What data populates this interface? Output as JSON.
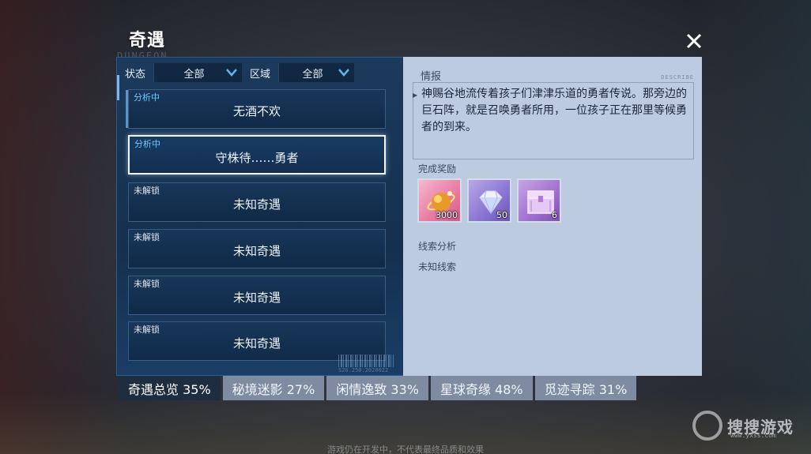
{
  "header": {
    "title": "奇遇",
    "close_icon": "close-icon"
  },
  "deco": {
    "dungeon": "DUNGEON",
    "describe": "DESCRIBE",
    "serial": "S20.250.2020022"
  },
  "filters": [
    {
      "label": "状态",
      "value": "全部"
    },
    {
      "label": "区域",
      "value": "全部"
    }
  ],
  "encounters": [
    {
      "status": "分析中",
      "name": "无酒不欢",
      "state": "active",
      "selected": false
    },
    {
      "status": "分析中",
      "name": "守株待……勇者",
      "state": "active",
      "selected": true
    },
    {
      "status": "未解锁",
      "name": "未知奇遇",
      "state": "locked",
      "selected": false
    },
    {
      "status": "未解锁",
      "name": "未知奇遇",
      "state": "locked",
      "selected": false
    },
    {
      "status": "未解锁",
      "name": "未知奇遇",
      "state": "locked",
      "selected": false
    },
    {
      "status": "未解锁",
      "name": "未知奇遇",
      "state": "locked",
      "selected": false
    }
  ],
  "detail": {
    "info_title": "情报",
    "info_text": "神赐谷地流传着孩子们津津乐道的勇者传说。那旁边的巨石阵，就是召唤勇者所用，一位孩子正在那里等候勇者的到来。",
    "reward_title": "完成奖励",
    "rewards": [
      {
        "icon": "gold-orb-icon",
        "qty": "3000"
      },
      {
        "icon": "diamond-icon",
        "qty": "50"
      },
      {
        "icon": "treasure-chest-icon",
        "qty": "6"
      }
    ],
    "clue_title": "线索分析",
    "clue_value": "未知线索"
  },
  "tabs": [
    {
      "label": "奇遇总览 35%",
      "active": true
    },
    {
      "label": "秘境迷影 27%",
      "active": false
    },
    {
      "label": "闲情逸致 33%",
      "active": false
    },
    {
      "label": "星球奇缘 48%",
      "active": false
    },
    {
      "label": "觅迹寻踪 31%",
      "active": false
    }
  ],
  "footer": "游戏仍在开发中，不代表最终品质和效果",
  "watermark": {
    "text": "搜搜游戏",
    "url": "www.yxss.com"
  },
  "colors": {
    "accent_blue": "#6ec9ff",
    "panel_dark": "#15304e",
    "panel_light": "#bccbe0"
  }
}
